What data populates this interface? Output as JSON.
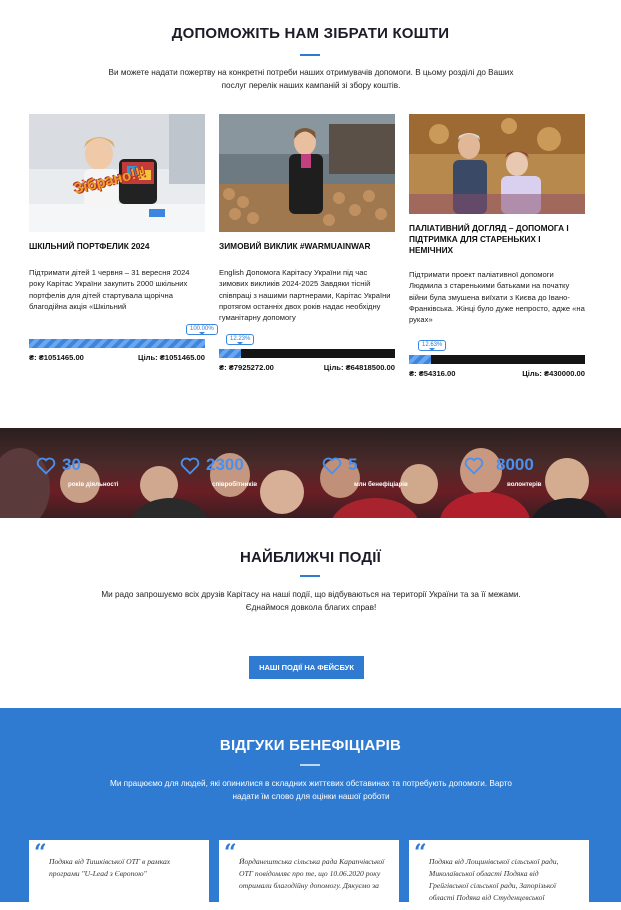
{
  "donate": {
    "title": "ДОПОМОЖІТЬ НАМ ЗІБРАТИ КОШТИ",
    "intro": "Ви можете надати пожертву на конкретні потреби наших отримувачів допомоги. В цьому розділі до Ваших послуг перелік наших кампаній зі збору коштів.",
    "campaigns": [
      {
        "title": "ШКІЛЬНИЙ ПОРТФЕЛИК 2024",
        "text": "  Підтримати дітей   1 червня – 31 вересня 2024 року Карітас України закупить 2000 шкільних портфелів для дітей стартувала щорічна благодійна акція «Шкільний",
        "photo_label": "Зібрано!!!",
        "percent_label": "100.00%",
        "percent": 100,
        "raised": "₴: ₴1051465.00",
        "goal": "Ціль: ₴1051465.00"
      },
      {
        "title": "ЗИМОВИЙ ВИКЛИК #WARMUAINWAR",
        "text": "English Допомога Карітасу України під час зимових викликів 2024-2025 Завдяки тісній співпраці з нашими партнерами, Карітас України протягом останніх двох років надає необхідну гуманітарну допомогу",
        "percent_label": "12.23%",
        "percent": 12.23,
        "raised": "₴: ₴7925272.00",
        "goal": "Ціль: ₴64818500.00"
      },
      {
        "title": "ПАЛІАТИВНИЙ ДОГЛЯД – ДОПОМОГА І ПІДТРИМКА ДЛЯ СТАРЕНЬКИХ І НЕМІЧНИХ",
        "text": "Підтримати проект паліативної допомоги Людмила з старенькими батьками на початку війни була змушена виїхати з Києва до Івано-Франківська. Жінці було дуже непросто, адже «на руках»",
        "percent_label": "12.63%",
        "percent": 12.63,
        "raised": "₴: ₴54316.00",
        "goal": "Ціль: ₴430000.00"
      }
    ]
  },
  "stats": [
    {
      "number": "30",
      "label": "років діяльності",
      "icon": "heart-outline-icon"
    },
    {
      "number": "2300",
      "label": "співробітників",
      "icon": "heart-outline-icon"
    },
    {
      "number": "5",
      "label": "млн бенефіціарів",
      "icon": "heart-outline-icon"
    },
    {
      "number": "8000",
      "label": "волонтерів",
      "icon": "heart-outline-icon"
    }
  ],
  "events": {
    "title": "НАЙБЛИЖЧІ ПОДІЇ",
    "intro": "Ми радо запрошуємо всіх друзів Карітасу на наші події, що відбуваються на території України та за її межами. Єднаймося довкола благих справ!",
    "button": "НАШІ ПОДІЇ НА ФЕЙСБУК"
  },
  "reviews": {
    "title": "ВІДГУКИ БЕНЕФІЦІАРІВ",
    "intro": "Ми працюємо для людей, які опинилися в складних життєвих обставинах та потребують допомоги. Варто надати їм слово для оцінки нашої роботи",
    "items": [
      {
        "text": "Подяка від Тишківської ОТГ в рамках програми \"U-Lead з Європою\""
      },
      {
        "text": "Йорданештська сільська рада Карапчівської ОТГ повідомляє про те, що 10.06.2020 року отримали благодійну допомогу. Дякуємо за"
      },
      {
        "text": "Подяка від Лощинівської сільської ради, Миколаївської області Подяка від Грейгівської сільської ради, Запорізької області Подяка від Студенцевської"
      }
    ]
  },
  "colors": {
    "accent": "#2e7bd1",
    "dark_bar": "#151515",
    "stat_number": "#4a90f0"
  }
}
